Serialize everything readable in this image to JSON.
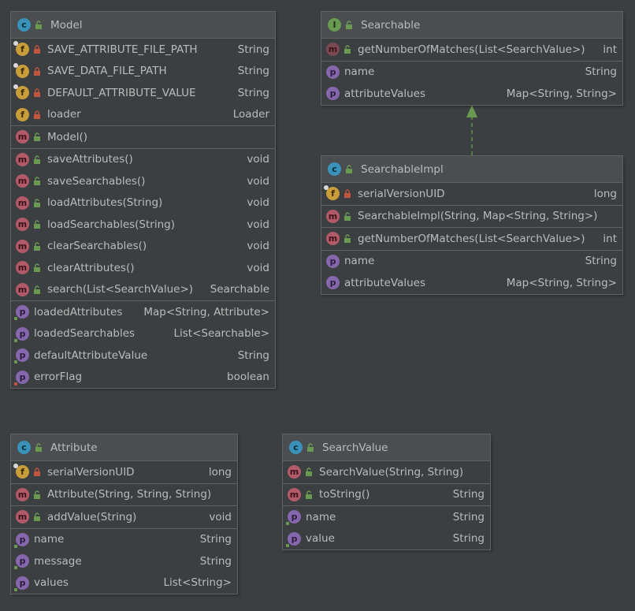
{
  "colors": {
    "background": "#3c3f41",
    "header": "#4b4e50",
    "border": "#616161",
    "text": "#bbbbbb",
    "class_icon": "#3a92b8",
    "interface_icon": "#6a9a52",
    "field_icon": "#c89d3a",
    "method_icon": "#b35a68",
    "property_icon": "#8666ad",
    "public_lock": "#6a9a52",
    "private_lock": "#c2553e",
    "arrow": "#6a9a52"
  },
  "model": {
    "title": "Model",
    "fields": [
      {
        "name": "SAVE_ATTRIBUTE_FILE_PATH",
        "type": "String"
      },
      {
        "name": "SAVE_DATA_FILE_PATH",
        "type": "String"
      },
      {
        "name": "DEFAULT_ATTRIBUTE_VALUE",
        "type": "String"
      },
      {
        "name": "loader",
        "type": "Loader"
      }
    ],
    "constructors": [
      {
        "name": "Model()",
        "type": ""
      }
    ],
    "methods": [
      {
        "name": "saveAttributes()",
        "type": "void"
      },
      {
        "name": "saveSearchables()",
        "type": "void"
      },
      {
        "name": "loadAttributes(String)",
        "type": "void"
      },
      {
        "name": "loadSearchables(String)",
        "type": "void"
      },
      {
        "name": "clearSearchables()",
        "type": "void"
      },
      {
        "name": "clearAttributes()",
        "type": "void"
      },
      {
        "name": "search(List<SearchValue>)",
        "type": "Searchable"
      }
    ],
    "properties": [
      {
        "name": "loadedAttributes",
        "type": "Map<String, Attribute>"
      },
      {
        "name": "loadedSearchables",
        "type": "List<Searchable>"
      },
      {
        "name": "defaultAttributeValue",
        "type": "String"
      },
      {
        "name": "errorFlag",
        "type": "boolean"
      }
    ]
  },
  "searchable": {
    "title": "Searchable",
    "methods": [
      {
        "name": "getNumberOfMatches(List<SearchValue>)",
        "type": "int"
      }
    ],
    "properties": [
      {
        "name": "name",
        "type": "String"
      },
      {
        "name": "attributeValues",
        "type": "Map<String, String>"
      }
    ]
  },
  "searchable_impl": {
    "title": "SearchableImpl",
    "fields": [
      {
        "name": "serialVersionUID",
        "type": "long"
      }
    ],
    "constructors": [
      {
        "name": "SearchableImpl(String, Map<String, String>)",
        "type": ""
      }
    ],
    "methods": [
      {
        "name": "getNumberOfMatches(List<SearchValue>)",
        "type": "int"
      }
    ],
    "properties": [
      {
        "name": "name",
        "type": "String"
      },
      {
        "name": "attributeValues",
        "type": "Map<String, String>"
      }
    ]
  },
  "attribute": {
    "title": "Attribute",
    "fields": [
      {
        "name": "serialVersionUID",
        "type": "long"
      }
    ],
    "constructors": [
      {
        "name": "Attribute(String, String, String)",
        "type": ""
      }
    ],
    "methods": [
      {
        "name": "addValue(String)",
        "type": "void"
      }
    ],
    "properties": [
      {
        "name": "name",
        "type": "String"
      },
      {
        "name": "message",
        "type": "String"
      },
      {
        "name": "values",
        "type": "List<String>"
      }
    ]
  },
  "search_value": {
    "title": "SearchValue",
    "constructors": [
      {
        "name": "SearchValue(String, String)",
        "type": ""
      }
    ],
    "methods": [
      {
        "name": "toString()",
        "type": "String"
      }
    ],
    "properties": [
      {
        "name": "name",
        "type": "String"
      },
      {
        "name": "value",
        "type": "String"
      }
    ]
  }
}
